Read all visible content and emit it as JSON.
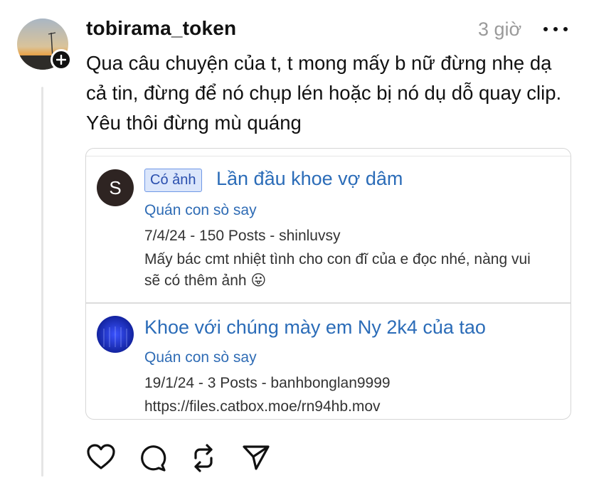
{
  "post": {
    "username": "tobirama_token",
    "timestamp": "3 giờ",
    "text": "Qua câu chuyện của t, t mong mấy b nữ đừng nhẹ dạ cả tin, đừng để nó chụp lén hoặc bị nó dụ dỗ quay clip. Yêu thôi đừng mù quáng"
  },
  "card": {
    "items": [
      {
        "avatar_letter": "S",
        "badge": "Có ảnh",
        "title": "Lần đầu khoe vợ dâm",
        "forum": "Quán con sò say",
        "meta": "7/4/24 - 150 Posts - shinluvsy",
        "snippet": "Mấy bác cmt nhiệt tình cho con đĩ của e đọc nhé, nàng vui sẽ có thêm ảnh 😛"
      },
      {
        "title": "Khoe với chúng mày em Ny 2k4 của tao",
        "forum": "Quán con sò say",
        "meta": "19/1/24 - 3 Posts - banhbonglan9999",
        "snippet": "https://files.catbox.moe/rn94hb.mov"
      }
    ]
  },
  "actions": [
    "heart-icon",
    "comment-icon",
    "repost-icon",
    "share-icon"
  ]
}
